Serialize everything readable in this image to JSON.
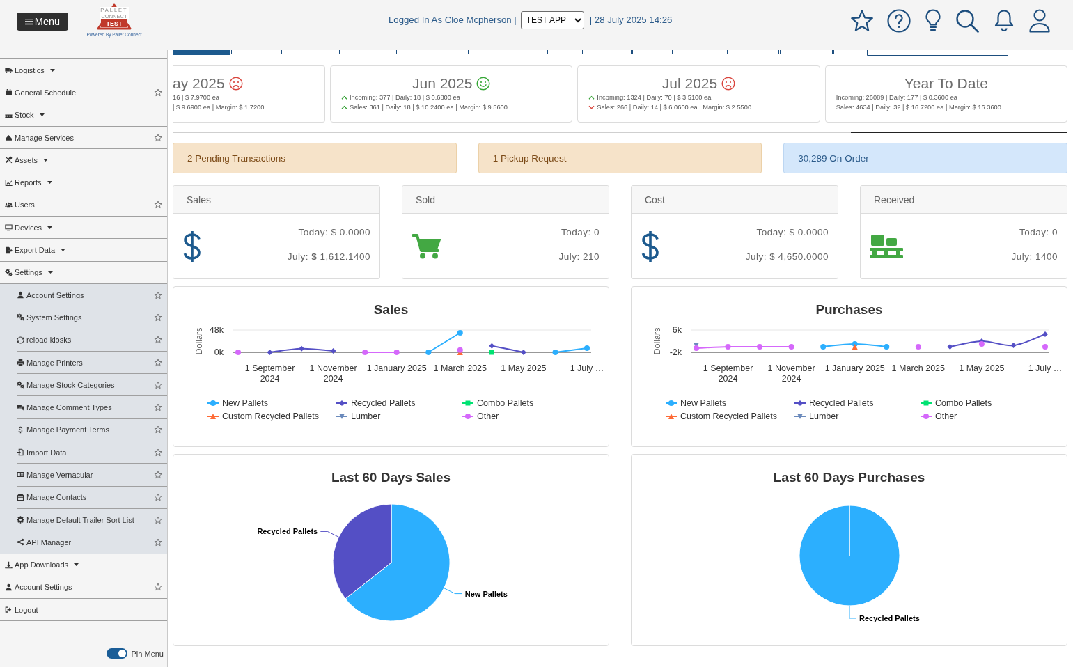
{
  "header": {
    "menu_button": "Menu",
    "logo": {
      "text_lines": [
        "PALLET",
        "CONNECT",
        "TEST"
      ],
      "tagline": "Powered By Pallet Connect"
    },
    "login_text": "Logged In As Cloe Mcpherson |",
    "app_select": {
      "value": "TEST APP"
    },
    "datetime_text": "| 28 July 2025 14:26"
  },
  "sidebar": {
    "items": [
      {
        "label": "Logistics",
        "kind": "menu"
      },
      {
        "label": "General Schedule",
        "kind": "page",
        "starred": false
      },
      {
        "label": "Stock",
        "kind": "menu"
      },
      {
        "label": "Manage Services",
        "kind": "page",
        "starred": false
      },
      {
        "label": "Assets",
        "kind": "menu"
      },
      {
        "label": "Reports",
        "kind": "menu"
      },
      {
        "label": "Users",
        "kind": "page",
        "starred": false
      },
      {
        "label": "Devices",
        "kind": "menu"
      },
      {
        "label": "Export Data",
        "kind": "menu"
      },
      {
        "label": "Settings",
        "kind": "menu",
        "expanded": true,
        "children": [
          {
            "label": "Account Settings",
            "kind": "page",
            "starred": false
          },
          {
            "label": "System Settings",
            "kind": "page",
            "starred": false
          },
          {
            "label": "reload kiosks",
            "kind": "page",
            "starred": false
          },
          {
            "label": "Manage Printers",
            "kind": "page",
            "starred": false
          },
          {
            "label": "Manage Stock Categories",
            "kind": "page",
            "starred": false
          },
          {
            "label": "Manage Comment Types",
            "kind": "page",
            "starred": false
          },
          {
            "label": "Manage Payment Terms",
            "kind": "page",
            "starred": false
          },
          {
            "label": "Import Data",
            "kind": "page",
            "starred": false
          },
          {
            "label": "Manage Vernacular",
            "kind": "page",
            "starred": false
          },
          {
            "label": "Manage Contacts",
            "kind": "page",
            "starred": false
          },
          {
            "label": "Manage Default Trailer Sort List",
            "kind": "page",
            "starred": false
          },
          {
            "label": "API Manager",
            "kind": "page",
            "starred": false
          }
        ]
      },
      {
        "label": "App Downloads",
        "kind": "menu"
      },
      {
        "label": "Account Settings",
        "kind": "page",
        "starred": false
      },
      {
        "label": "Logout",
        "kind": "action"
      }
    ],
    "pin_menu": {
      "label": "Pin Menu",
      "on": true
    }
  },
  "month_cards": [
    {
      "title": "ay 2025",
      "positive": false,
      "cut_off": true,
      "lines": [
        {
          "text": "16 | $ 7.9700 ea"
        },
        {
          "text": "| $ 9.6900 ea | Margin: $ 1.7200"
        }
      ]
    },
    {
      "title": "Jun 2025",
      "positive": true,
      "lines": [
        {
          "text": "Incoming: 377 | Daily: 18 | $ 0.6800 ea",
          "rising": true
        },
        {
          "text": "Sales: 361 | Daily: 18 | $ 10.2400 ea | Margin: $ 9.5600",
          "rising": true
        }
      ]
    },
    {
      "title": "Jul 2025",
      "positive": false,
      "lines": [
        {
          "text": "Incoming: 1324 | Daily: 70 | $ 3.5100 ea",
          "rising": true
        },
        {
          "text": "Sales: 266 | Daily: 14 | $ 6.0600 ea | Margin: $ 2.5500",
          "rising": false
        }
      ]
    },
    {
      "title": "Year To Date",
      "lines": [
        {
          "text": "Incoming: 26089 | Daily: 177 | $ 0.3600 ea"
        },
        {
          "text": "Sales: 4634 | Daily: 32 | $ 16.7200 ea | Margin: $ 16.3600"
        }
      ]
    }
  ],
  "alerts": [
    {
      "text": "2 Pending Transactions",
      "kind": "warning"
    },
    {
      "text": "1 Pickup Request",
      "kind": "warning"
    },
    {
      "text": "30,289 On Order",
      "kind": "info"
    }
  ],
  "stat_panels": [
    {
      "title": "Sales",
      "today": "Today: $ 0.0000",
      "month": "July: $ 1,612.1400"
    },
    {
      "title": "Sold",
      "today": "Today: 0",
      "month": "July: 210"
    },
    {
      "title": "Cost",
      "today": "Today: $ 0.0000",
      "month": "July: $ 4,650.0000"
    },
    {
      "title": "Received",
      "today": "Today: 0",
      "month": "July: 1400"
    }
  ],
  "line_charts": [
    {
      "chart_data": {
        "type": "line",
        "title": "Sales",
        "ylabel": "Dollars",
        "categories": [
          null,
          "1 September 2024",
          null,
          "1 November 2024",
          null,
          "1 January 2025",
          null,
          "1 March 2025",
          null,
          "1 May 2025",
          null,
          "1 July …"
        ],
        "ylim": [
          0,
          48000
        ],
        "yticks": [
          {
            "value": 0,
            "label": "0k"
          },
          {
            "value": 48000,
            "label": "48k"
          }
        ],
        "legend": "bottom",
        "series": [
          {
            "name": "New Pallets",
            "color": "#2caffe",
            "marker": "circle",
            "values": [
              null,
              null,
              null,
              null,
              null,
              null,
              0,
              42000,
              null,
              null,
              0,
              9000
            ]
          },
          {
            "name": "Recycled Pallets",
            "color": "#544fc5",
            "marker": "diamond",
            "values": [
              null,
              0,
              8000,
              3000,
              null,
              null,
              null,
              null,
              14000,
              0,
              null,
              null
            ]
          },
          {
            "name": "Combo Pallets",
            "color": "#00e272",
            "marker": "square",
            "values": [
              null,
              null,
              null,
              null,
              null,
              null,
              null,
              null,
              0,
              null,
              null,
              null
            ]
          },
          {
            "name": "Custom Recycled Pallets",
            "color": "#fe6a35",
            "marker": "triangle",
            "values": [
              null,
              null,
              null,
              null,
              null,
              null,
              null,
              0,
              null,
              null,
              null,
              null
            ]
          },
          {
            "name": "Lumber",
            "color": "#6b8abc",
            "marker": "triangle-down",
            "values": [
              null,
              null,
              null,
              null,
              null,
              null,
              null,
              null,
              null,
              null,
              null,
              null
            ]
          },
          {
            "name": "Other",
            "color": "#d568fb",
            "marker": "circle",
            "values": [
              0,
              null,
              null,
              null,
              0,
              0,
              null,
              5000,
              null,
              null,
              null,
              null
            ]
          }
        ]
      }
    },
    {
      "chart_data": {
        "type": "line",
        "title": "Purchases",
        "ylabel": "Dollars",
        "categories": [
          null,
          "1 September 2024",
          null,
          "1 November 2024",
          null,
          "1 January 2025",
          null,
          "1 March 2025",
          null,
          "1 May 2025",
          null,
          "1 July …"
        ],
        "ylim": [
          -2000,
          6000
        ],
        "yticks": [
          {
            "value": -2000,
            "label": "-2k"
          },
          {
            "value": 6000,
            "label": "6k"
          }
        ],
        "legend": "bottom",
        "series": [
          {
            "name": "New Pallets",
            "color": "#2caffe",
            "marker": "circle",
            "values": [
              null,
              null,
              null,
              null,
              0,
              1000,
              0,
              null,
              null,
              null,
              null,
              null
            ]
          },
          {
            "name": "Recycled Pallets",
            "color": "#544fc5",
            "marker": "diamond",
            "values": [
              null,
              null,
              null,
              null,
              null,
              null,
              null,
              null,
              0,
              2000,
              500,
              4500
            ]
          },
          {
            "name": "Combo Pallets",
            "color": "#00e272",
            "marker": "square",
            "values": [
              null,
              null,
              null,
              null,
              null,
              null,
              null,
              null,
              null,
              null,
              null,
              null
            ]
          },
          {
            "name": "Custom Recycled Pallets",
            "color": "#fe6a35",
            "marker": "triangle",
            "values": [
              null,
              null,
              null,
              null,
              null,
              0,
              null,
              null,
              null,
              null,
              null,
              null
            ]
          },
          {
            "name": "Lumber",
            "color": "#6b8abc",
            "marker": "triangle-down",
            "values": [
              500,
              null,
              null,
              null,
              null,
              null,
              null,
              null,
              null,
              null,
              null,
              null
            ]
          },
          {
            "name": "Other",
            "color": "#d568fb",
            "marker": "circle",
            "values": [
              -500,
              0,
              0,
              0,
              null,
              null,
              null,
              0,
              null,
              1000,
              null,
              0
            ]
          }
        ]
      }
    }
  ],
  "pie_charts": [
    {
      "chart_data": {
        "type": "pie",
        "title": "Last 60 Days Sales",
        "categories": [
          "New Pallets",
          "Recycled Pallets"
        ],
        "values": [
          64.4,
          35.6
        ]
      }
    },
    {
      "chart_data": {
        "type": "pie",
        "title": "Last 60 Days Purchases",
        "categories": [
          "Recycled Pallets"
        ],
        "values": [
          100
        ]
      }
    }
  ]
}
